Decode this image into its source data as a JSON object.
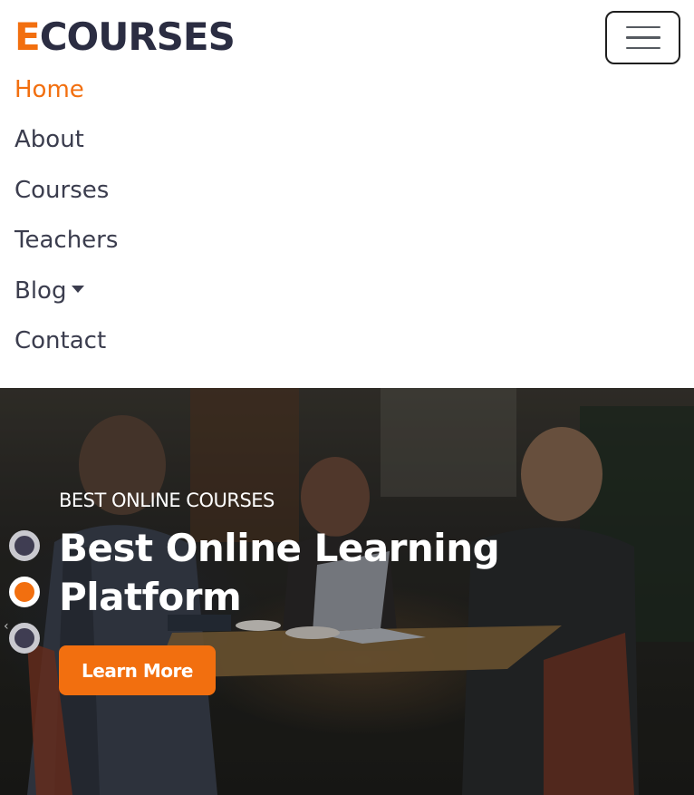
{
  "brand": {
    "accent": "E",
    "rest": "COURSES"
  },
  "nav": {
    "toggler_icon": "hamburger-icon",
    "items": [
      {
        "label": "Home",
        "active": true
      },
      {
        "label": "About",
        "active": false
      },
      {
        "label": "Courses",
        "active": false
      },
      {
        "label": "Teachers",
        "active": false
      },
      {
        "label": "Blog",
        "active": false,
        "dropdown": true,
        "dropdown_icon": "caret-down-icon"
      },
      {
        "label": "Contact",
        "active": false
      }
    ]
  },
  "carousel": {
    "subtitle": "BEST ONLINE COURSES",
    "title": "Best Online Learning Platform",
    "cta_label": "Learn More",
    "slide_count": 3,
    "active_slide": 2,
    "prev_icon": "chevron-left-icon"
  },
  "colors": {
    "accent": "#f26f0f",
    "text_dark": "#2b2d42",
    "nav_text": "#3b3d4e",
    "indicator_inactive": "#3f3d52"
  }
}
